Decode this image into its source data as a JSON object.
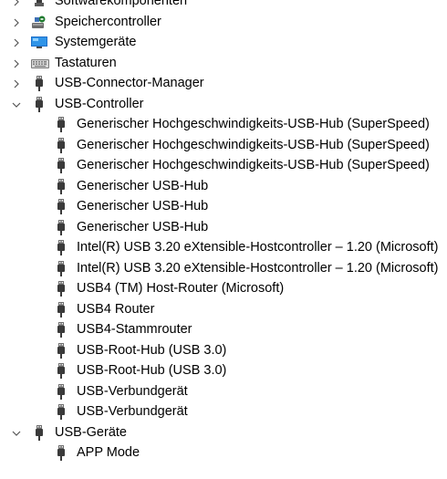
{
  "tree": {
    "top_items": [
      {
        "label": "Softwarekomponenten",
        "icon": "software-components-icon",
        "state": "collapsed"
      },
      {
        "label": "Speichercontroller",
        "icon": "storage-controller-icon",
        "state": "collapsed"
      },
      {
        "label": "Systemgeräte",
        "icon": "system-devices-icon",
        "state": "collapsed"
      },
      {
        "label": "Tastaturen",
        "icon": "keyboard-icon",
        "state": "collapsed"
      },
      {
        "label": "USB-Connector-Manager",
        "icon": "usb-plug-icon",
        "state": "collapsed"
      },
      {
        "label": "USB-Controller",
        "icon": "usb-plug-icon",
        "state": "expanded"
      }
    ],
    "usb_controller_children": [
      "Generischer Hochgeschwindigkeits-USB-Hub (SuperSpeed)",
      "Generischer Hochgeschwindigkeits-USB-Hub (SuperSpeed)",
      "Generischer Hochgeschwindigkeits-USB-Hub (SuperSpeed)",
      "Generischer USB-Hub",
      "Generischer USB-Hub",
      "Generischer USB-Hub",
      "Intel(R) USB 3.20 eXtensible-Hostcontroller – 1.20 (Microsoft)",
      "Intel(R) USB 3.20 eXtensible-Hostcontroller – 1.20 (Microsoft)",
      "USB4 (TM) Host-Router (Microsoft)",
      "USB4 Router",
      "USB4-Stammrouter",
      "USB-Root-Hub (USB 3.0)",
      "USB-Root-Hub (USB 3.0)",
      "USB-Verbundgerät",
      "USB-Verbundgerät"
    ],
    "usb_devices": {
      "label": "USB-Geräte",
      "icon": "usb-plug-icon",
      "state": "expanded"
    },
    "usb_devices_children": [
      "APP Mode"
    ]
  },
  "colors": {
    "text": "#000000",
    "chevron": "#555555",
    "usb_icon": "#3a3a3a"
  }
}
